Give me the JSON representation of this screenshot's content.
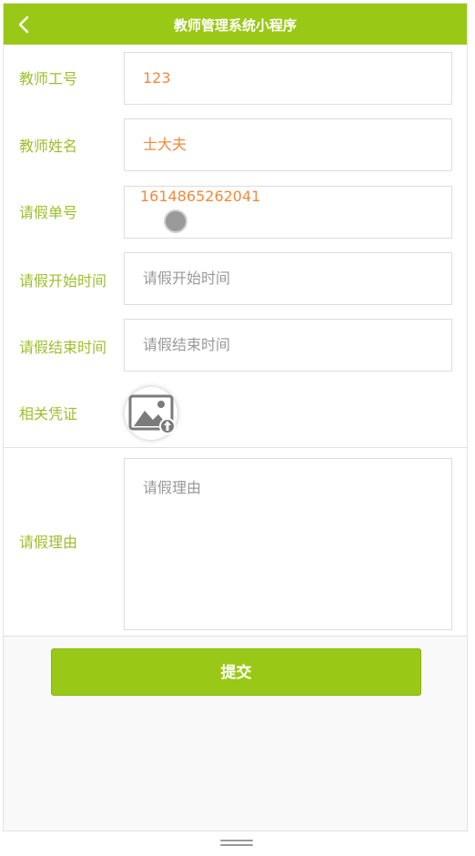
{
  "header": {
    "title": "教师管理系统小程序",
    "back_icon": "chevron-left-icon"
  },
  "colors": {
    "accent": "#99c916",
    "label": "#9cbf2b",
    "value": "#f08a3c"
  },
  "form": {
    "teacher_id": {
      "label": "教师工号",
      "value": "123"
    },
    "teacher_name": {
      "label": "教师姓名",
      "value": "士大夫"
    },
    "leave_no": {
      "label": "请假单号",
      "value": "1614865262041"
    },
    "start_time": {
      "label": "请假开始时间",
      "placeholder": "请假开始时间"
    },
    "end_time": {
      "label": "请假结束时间",
      "placeholder": "请假结束时间"
    },
    "proof": {
      "label": "相关凭证",
      "icon": "image-upload-icon"
    },
    "reason": {
      "label": "请假理由",
      "placeholder": "请假理由"
    }
  },
  "submit_label": "提交"
}
